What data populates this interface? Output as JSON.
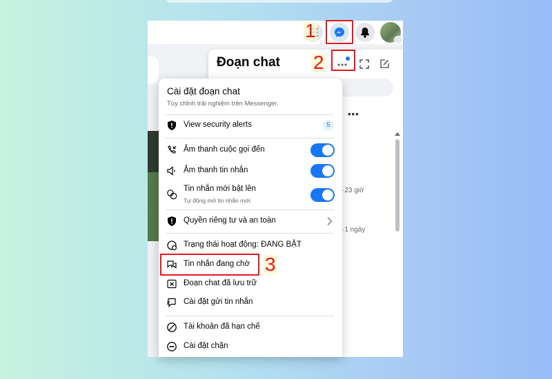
{
  "chat_panel": {
    "title": "Đoạn chat",
    "conv_times": [
      "·23 giờ",
      "·1 ngày"
    ]
  },
  "settings": {
    "title": "Cài đặt đoạn chat",
    "subtitle": "Tùy chỉnh trải nghiệm trên Messenger.",
    "security_alerts": {
      "label": "View security alerts",
      "count": "5"
    },
    "call_sounds": {
      "label": "Âm thanh cuộc gọi đến",
      "on": true
    },
    "message_sounds": {
      "label": "Âm thanh tin nhắn",
      "on": true
    },
    "popup_messages": {
      "label": "Tin nhắn mới bật lên",
      "sub": "Tự động mở tin nhắn mới.",
      "on": true
    },
    "privacy": {
      "label": "Quyền riêng tư và an toàn"
    },
    "active_status": {
      "label": "Trạng thái hoạt động: ĐANG BẬT"
    },
    "message_requests": {
      "label": "Tin nhắn đang chờ"
    },
    "archived": {
      "label": "Đoạn chat đã lưu trữ"
    },
    "delivery": {
      "label": "Cài đặt gửi tin nhắn"
    },
    "restricted": {
      "label": "Tài khoản đã hạn chế"
    },
    "blocking": {
      "label": "Cài đặt chặn"
    }
  },
  "annotations": {
    "step1": "1",
    "step2": "2",
    "step3": "3",
    "color": "#e5171d"
  },
  "colors": {
    "accent": "#1877f2",
    "background_gradient": [
      "#c6f2df",
      "#97bcf7"
    ]
  }
}
